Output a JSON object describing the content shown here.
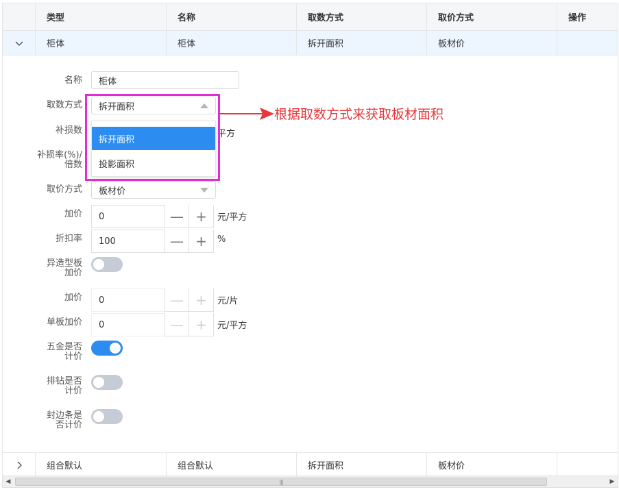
{
  "table": {
    "headers": [
      "类型",
      "名称",
      "取数方式",
      "取价方式",
      "操作"
    ],
    "rows": [
      {
        "type": "柜体",
        "name": "柜体",
        "qty_mode": "拆开面积",
        "price_mode": "板材价",
        "action": ""
      },
      {
        "type": "组合默认",
        "name": "组合默认",
        "qty_mode": "拆开面积",
        "price_mode": "板材价",
        "action": ""
      }
    ]
  },
  "form": {
    "name_label": "名称",
    "name_value": "柜体",
    "qty_mode_label": "取数方式",
    "qty_mode_value": "拆开面积",
    "loss_label": "补损数",
    "loss_unit": "平方",
    "loss_rate_label_1": "补损率(%)/",
    "loss_rate_label_2": "倍数",
    "price_mode_label": "取价方式",
    "price_mode_value": "板材价",
    "markup_label": "加价",
    "markup_value": "0",
    "markup_unit": "元/平方",
    "discount_label": "折扣率",
    "discount_value": "100",
    "discount_unit": "%",
    "shaped_label_1": "异造型板",
    "shaped_label_2": "加价",
    "shaped_on": false,
    "piece_markup_label": "加价",
    "piece_markup_value": "0",
    "piece_markup_unit": "元/片",
    "single_markup_label": "单板加价",
    "single_markup_value": "0",
    "single_markup_unit": "元/平方",
    "hardware_label_1": "五金是否",
    "hardware_label_2": "计价",
    "hardware_on": true,
    "drill_label_1": "排钻是否",
    "drill_label_2": "计价",
    "drill_on": false,
    "edge_label_1": "封边条是",
    "edge_label_2": "否计价",
    "edge_on": false,
    "minus_glyph": "—",
    "plus_glyph": "+"
  },
  "dropdown": {
    "options": [
      "拆开面积",
      "投影面积"
    ],
    "selected_index": 0
  },
  "annotation": {
    "text": "根据取数方式来获取板材面积",
    "color": "#e8363a",
    "box_color": "#e52bd6"
  },
  "scrollbar": {
    "left": "◀",
    "right": "▶",
    "grip": "|||"
  },
  "colors": {
    "accent": "#2d8cf0",
    "selected_row": "#edf6ff",
    "header_bg": "#f5f6f8"
  }
}
